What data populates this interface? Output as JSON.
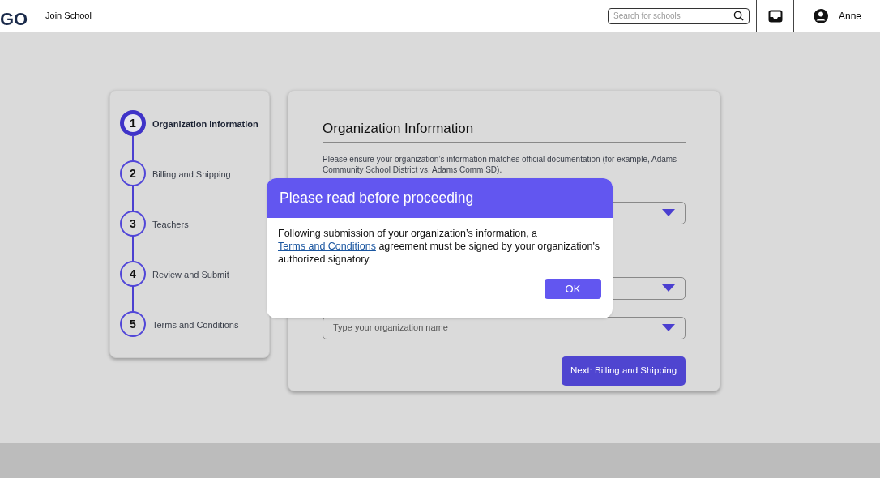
{
  "header": {
    "logo": "GO",
    "nav_link": "Join School",
    "search": {
      "placeholder": "Search for schools"
    },
    "user_name": "Anne"
  },
  "steps": [
    {
      "number": "1",
      "label": "Organization Information",
      "selected": true
    },
    {
      "number": "2",
      "label": "Billing and Shipping",
      "selected": false
    },
    {
      "number": "3",
      "label": "Teachers",
      "selected": false
    },
    {
      "number": "4",
      "label": "Review and Submit",
      "selected": false
    },
    {
      "number": "5",
      "label": "Terms and Conditions",
      "selected": false
    }
  ],
  "form": {
    "title": "Organization Information",
    "note": "Please ensure your organization’s information matches official documentation (for example, Adams Community School District vs. Adams Comm SD).",
    "selects": [
      {
        "kind": "dropdown"
      },
      {
        "kind": "dropdown"
      },
      {
        "kind": "dropdown",
        "placeholder": "Type your organization name"
      }
    ],
    "next_button": "Next: Billing and Shipping"
  },
  "dialog": {
    "title": "Please read before proceeding",
    "text_before": "Following submission of your organization’s information, a",
    "link": "Terms and Conditions",
    "text_after": "agreement must be signed by your organization's authorized signatory.",
    "button": "OK"
  }
}
